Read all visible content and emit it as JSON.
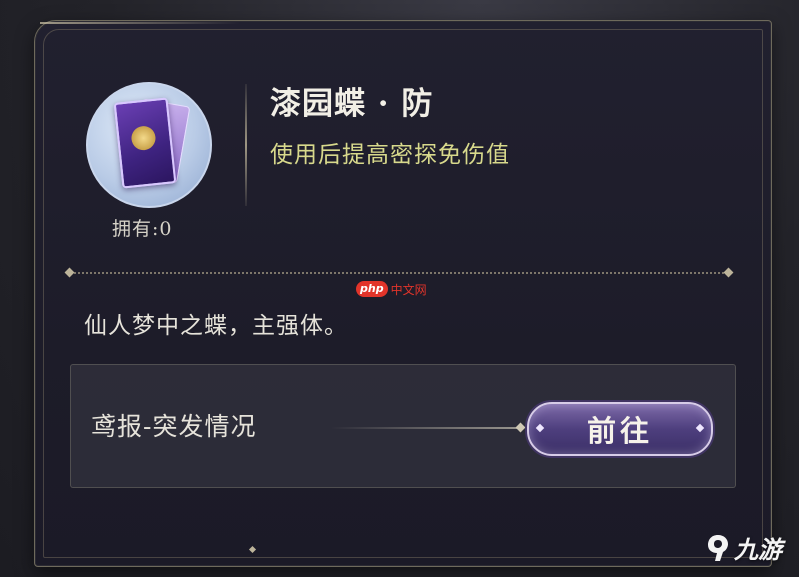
{
  "item": {
    "name": "漆园蝶 · 防",
    "effect": "使用后提高密探免伤值",
    "owned_label": "拥有:0",
    "description": "仙人梦中之蝶，主强体。",
    "icon": "butterfly-card-icon"
  },
  "source": {
    "label": "鸢报-突发情况",
    "go_button": "前往"
  },
  "watermark": {
    "logo": "php",
    "text": "中文网"
  },
  "brand": {
    "text": "九游",
    "icon": "nine-game-logo-icon"
  },
  "colors": {
    "title": "#f2efe6",
    "effect": "#d8d98c",
    "button": "#4e3f7e"
  }
}
